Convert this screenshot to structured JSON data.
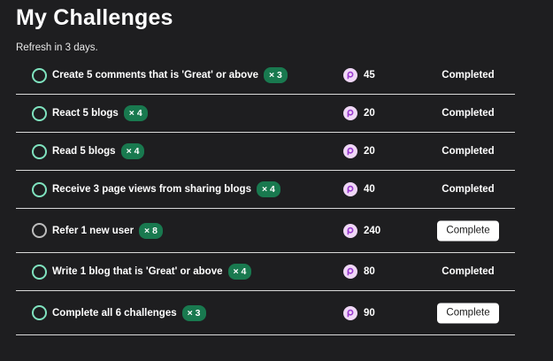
{
  "page": {
    "title": "My Challenges",
    "refresh_text": "Refresh in 3 days."
  },
  "colors": {
    "background": "#1e1e20",
    "completed_ring": "#7fe3bf",
    "pending_ring": "#bdbdbd",
    "multiplier_badge": "#19794f",
    "points_coin": "#f0d7f7",
    "points_coin_glyph": "#9a3ad0",
    "button_bg": "#ffffff"
  },
  "icons": {
    "status": "circle-ring-icon",
    "points": "points-coin-icon"
  },
  "challenges": [
    {
      "name": "Create 5 comments that is 'Great' or above",
      "multiplier": "× 3",
      "points": "45",
      "state": "completed",
      "status_label": "Completed"
    },
    {
      "name": "React 5 blogs",
      "multiplier": "× 4",
      "points": "20",
      "state": "completed",
      "status_label": "Completed"
    },
    {
      "name": "Read 5 blogs",
      "multiplier": "× 4",
      "points": "20",
      "state": "completed",
      "status_label": "Completed"
    },
    {
      "name": "Receive 3 page views from sharing blogs",
      "multiplier": "× 4",
      "points": "40",
      "state": "completed",
      "status_label": "Completed"
    },
    {
      "name": "Refer 1 new user",
      "multiplier": "× 8",
      "points": "240",
      "state": "pending",
      "button_label": "Complete"
    },
    {
      "name": "Write 1 blog that is 'Great' or above",
      "multiplier": "× 4",
      "points": "80",
      "state": "completed",
      "status_label": "Completed"
    },
    {
      "name": "Complete all 6 challenges",
      "multiplier": "× 3",
      "points": "90",
      "state": "completed-ring",
      "button_label": "Complete"
    }
  ]
}
